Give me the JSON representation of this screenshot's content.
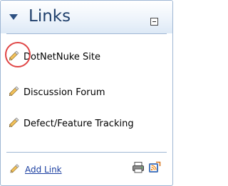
{
  "module": {
    "title": "Links",
    "collapse_icon": "triangle-down-icon",
    "minimize_icon": "minimize-box-icon"
  },
  "links": [
    {
      "label": "DotNetNuke Site",
      "icon": "pencil-icon"
    },
    {
      "label": "Discussion Forum",
      "icon": "pencil-icon"
    },
    {
      "label": "Defect/Feature Tracking",
      "icon": "pencil-icon"
    }
  ],
  "footer": {
    "add_link_label": "Add Link",
    "add_link_icon": "pencil-icon",
    "print_icon": "printer-icon",
    "syndicate_icon": "rss-feed-icon"
  },
  "colors": {
    "title": "#1f3f6b",
    "border": "#9fb7d4",
    "link": "#1a3ea0",
    "highlight": "#e04545"
  }
}
